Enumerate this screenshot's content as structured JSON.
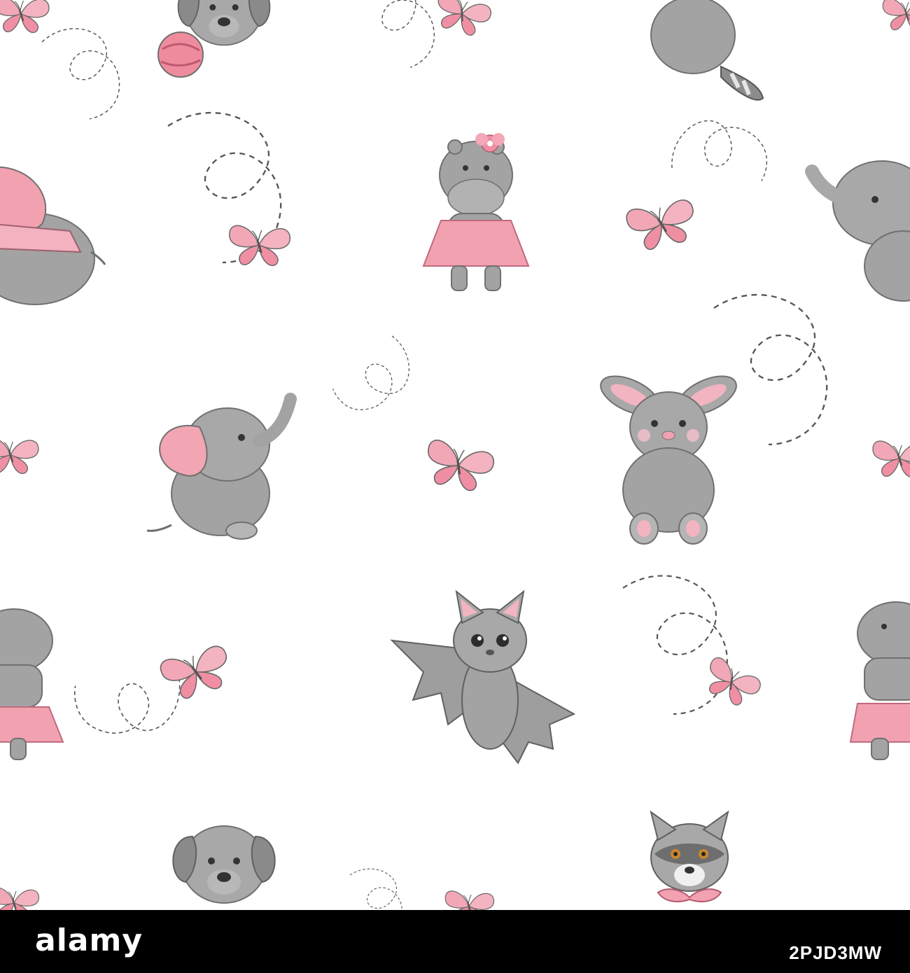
{
  "footer": {
    "brand": "alamy",
    "image_id": "2PJD3MW"
  },
  "colors": {
    "background": "#ffffff",
    "animal_gray": "#9a9a9a",
    "animal_gray_light": "#b8b8b8",
    "outline": "#555555",
    "accent_pink": "#f0a0b0",
    "footer_background": "#000000",
    "footer_text": "#ffffff"
  },
  "illustration": {
    "motifs": [
      "dog-with-ball",
      "raccoon",
      "hippo-in-pink-dress",
      "elephant-with-blanket",
      "elephant-sitting",
      "bunny",
      "bat",
      "butterfly",
      "dashed-flight-path"
    ]
  }
}
